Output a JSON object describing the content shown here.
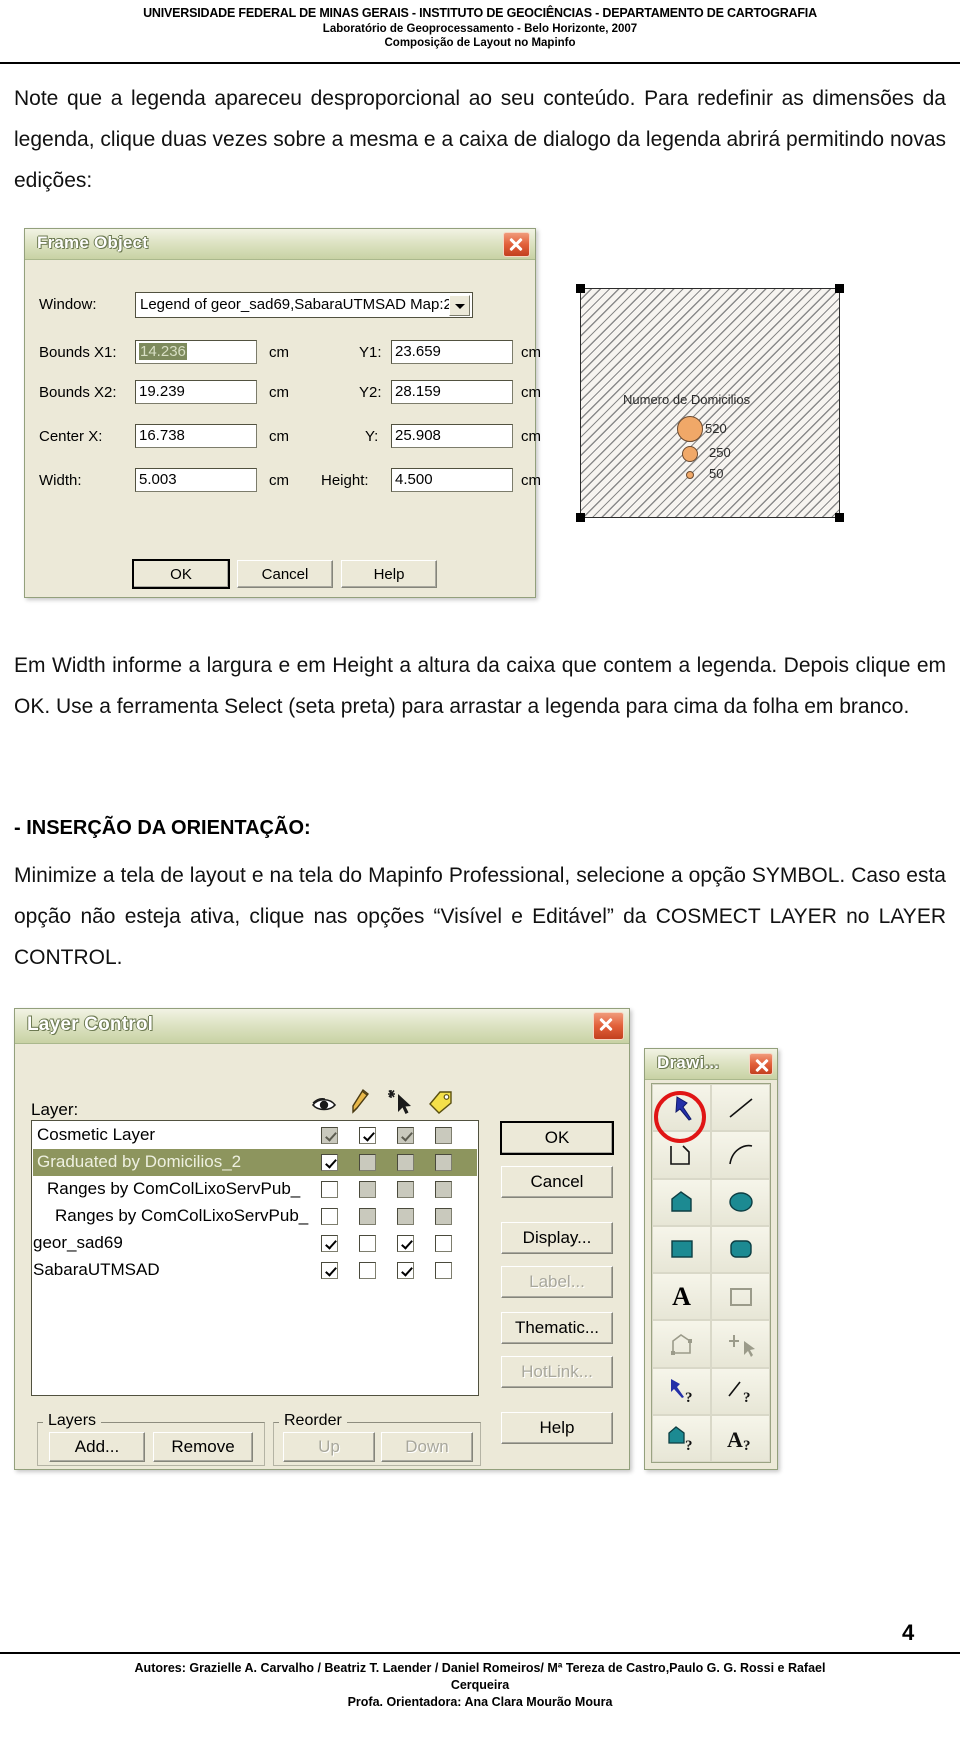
{
  "header": {
    "line1": "UNIVERSIDADE FEDERAL DE MINAS GERAIS - INSTITUTO DE GEOCIÊNCIAS - DEPARTAMENTO DE CARTOGRAFIA",
    "line2": "Laboratório de Geoprocessamento - Belo Horizonte, 2007",
    "line3": "Composição de Layout no Mapinfo"
  },
  "body": {
    "para1": "Note que a legenda apareceu desproporcional ao seu conteúdo. Para redefinir as dimensões da legenda, clique duas vezes sobre a mesma e a caixa de dialogo da legenda abrirá permitindo novas edições:",
    "para2": "Em Width informe a largura e em Height a altura da caixa que contem a legenda. Depois clique em OK. Use a ferramenta Select (seta preta) para arrastar a legenda para cima da folha em branco.",
    "heading1": "- INSERÇÃO DA ORIENTAÇÃO:",
    "para3": "Minimize a tela de layout e na tela do Mapinfo Professional, selecione a opção SYMBOL. Caso esta opção não esteja ativa, clique nas opções “Visível e Editável” da COSMECT LAYER no LAYER CONTROL."
  },
  "frame_object_dialog": {
    "title": "Frame Object",
    "close_icon": "close-icon",
    "window_label": "Window:",
    "window_value": "Legend of geor_sad69,SabaraUTMSAD Map:2",
    "fields": [
      {
        "label": "Bounds X1:",
        "value": "14.236",
        "unit": "cm",
        "selected": true
      },
      {
        "label": "Y1:",
        "value": "23.659",
        "unit": "cm",
        "selected": false
      },
      {
        "label": "Bounds X2:",
        "value": "19.239",
        "unit": "cm",
        "selected": false
      },
      {
        "label": "Y2:",
        "value": "28.159",
        "unit": "cm",
        "selected": false
      },
      {
        "label": "Center X:",
        "value": "16.738",
        "unit": "cm",
        "selected": false
      },
      {
        "label": "Y:",
        "value": "25.908",
        "unit": "cm",
        "selected": false
      },
      {
        "label": "Width:",
        "value": "5.003",
        "unit": "cm",
        "selected": false
      },
      {
        "label": "Height:",
        "value": "4.500",
        "unit": "cm",
        "selected": false
      }
    ],
    "buttons": {
      "ok": "OK",
      "cancel": "Cancel",
      "help": "Help"
    }
  },
  "legend_preview": {
    "title": "Numero de Domicilios",
    "items": [
      {
        "label": "520",
        "size": 22
      },
      {
        "label": "250",
        "size": 13
      },
      {
        "label": "50",
        "size": 5
      }
    ],
    "dot_color": "#f0a868"
  },
  "layer_control_dialog": {
    "title": "Layer Control",
    "close_icon": "close-icon",
    "layer_label": "Layer:",
    "column_icons": [
      "eye-icon",
      "pencil-icon",
      "select-arrow-icon",
      "label-tag-icon"
    ],
    "layers": [
      {
        "name": "Cosmetic Layer",
        "visible": "checked-gray",
        "editable": "checked",
        "selectable": "checked-gray",
        "labeled": "unchecked-gray",
        "highlighted": false
      },
      {
        "name": "Graduated by Domicilios_2",
        "visible": "checked",
        "editable": "unchecked-gray",
        "selectable": "unchecked-gray",
        "labeled": "unchecked-gray",
        "highlighted": true
      },
      {
        "name": "Ranges by ComColLixoServPub_",
        "visible": "unchecked",
        "editable": "unchecked-gray",
        "selectable": "unchecked-gray",
        "labeled": "unchecked-gray",
        "highlighted": false
      },
      {
        "name": "Ranges by ComColLixoServPub_",
        "visible": "unchecked",
        "editable": "unchecked-gray",
        "selectable": "unchecked-gray",
        "labeled": "unchecked-gray",
        "highlighted": false
      },
      {
        "name": "geor_sad69",
        "visible": "checked",
        "editable": "unchecked",
        "selectable": "checked",
        "labeled": "unchecked",
        "highlighted": false
      },
      {
        "name": "SabaraUTMSAD",
        "visible": "checked",
        "editable": "unchecked",
        "selectable": "checked",
        "labeled": "unchecked",
        "highlighted": false
      }
    ],
    "side_buttons": [
      {
        "label": "OK",
        "state": "default"
      },
      {
        "label": "Cancel",
        "state": "normal"
      },
      {
        "label": "Display...",
        "state": "normal"
      },
      {
        "label": "Label...",
        "state": "disabled"
      },
      {
        "label": "Thematic...",
        "state": "normal"
      },
      {
        "label": "HotLink...",
        "state": "disabled"
      },
      {
        "label": "Help",
        "state": "normal"
      }
    ],
    "groups": {
      "layers": "Layers",
      "reorder": "Reorder"
    },
    "bottom_buttons": [
      {
        "label": "Add...",
        "state": "normal"
      },
      {
        "label": "Remove",
        "state": "normal"
      },
      {
        "label": "Up",
        "state": "disabled"
      },
      {
        "label": "Down",
        "state": "disabled"
      }
    ]
  },
  "drawing_toolbar": {
    "title": "Drawi...",
    "close_icon": "close-icon",
    "tools": [
      "symbol-pin-icon",
      "line-icon",
      "polyline-icon",
      "arc-icon",
      "polygon-icon",
      "ellipse-icon",
      "rectangle-icon",
      "rounded-rectangle-icon",
      "text-icon",
      "frame-icon",
      "add-node-icon",
      "add-point-icon",
      "symbol-style-icon",
      "line-style-icon",
      "region-style-icon",
      "text-style-icon"
    ],
    "highlighted_tool": "symbol-pin-icon"
  },
  "footer": {
    "authors": "Autores: Grazielle A. Carvalho / Beatriz T. Laender / Daniel Romeiros/ Mª Tereza de Castro,Paulo G. G. Rossi  e Rafael",
    "authors2": "Cerqueira",
    "advisor": "Profa. Orientadora: Ana Clara Mourão Moura",
    "page": "4"
  }
}
